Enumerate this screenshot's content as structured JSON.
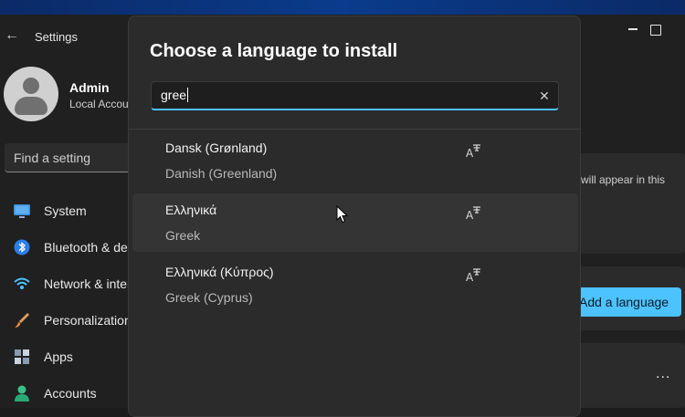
{
  "settings": {
    "title": "Settings",
    "user": {
      "name": "Admin",
      "account_type": "Local Account"
    },
    "search_placeholder": "Find a setting",
    "nav": [
      {
        "label": "System",
        "icon": "monitor-icon"
      },
      {
        "label": "Bluetooth & devices",
        "icon": "bluetooth-icon"
      },
      {
        "label": "Network & internet",
        "icon": "wifi-icon"
      },
      {
        "label": "Personalization",
        "icon": "brush-icon"
      },
      {
        "label": "Apps",
        "icon": "apps-icon"
      },
      {
        "label": "Accounts",
        "icon": "person-icon"
      }
    ],
    "content": {
      "appear_text": "will appear in this",
      "add_language_label": "Add a language",
      "more_label": "..."
    }
  },
  "dialog": {
    "title": "Choose a language to install",
    "search": {
      "value": "gree",
      "clear_icon": "clear-icon"
    },
    "languages": [
      {
        "native": "Dansk (Grønland)",
        "english": "Danish (Greenland)",
        "feature_icon": "text-to-speech-icon"
      },
      {
        "native": "Ελληνικά",
        "english": "Greek",
        "feature_icon": "text-to-speech-icon"
      },
      {
        "native": "Ελληνικά (Κύπρος)",
        "english": "Greek (Cyprus)",
        "feature_icon": "text-to-speech-icon"
      }
    ]
  },
  "colors": {
    "accent": "#4cc2ff",
    "dialog_bg": "#2b2b2b",
    "window_bg": "#202020"
  }
}
